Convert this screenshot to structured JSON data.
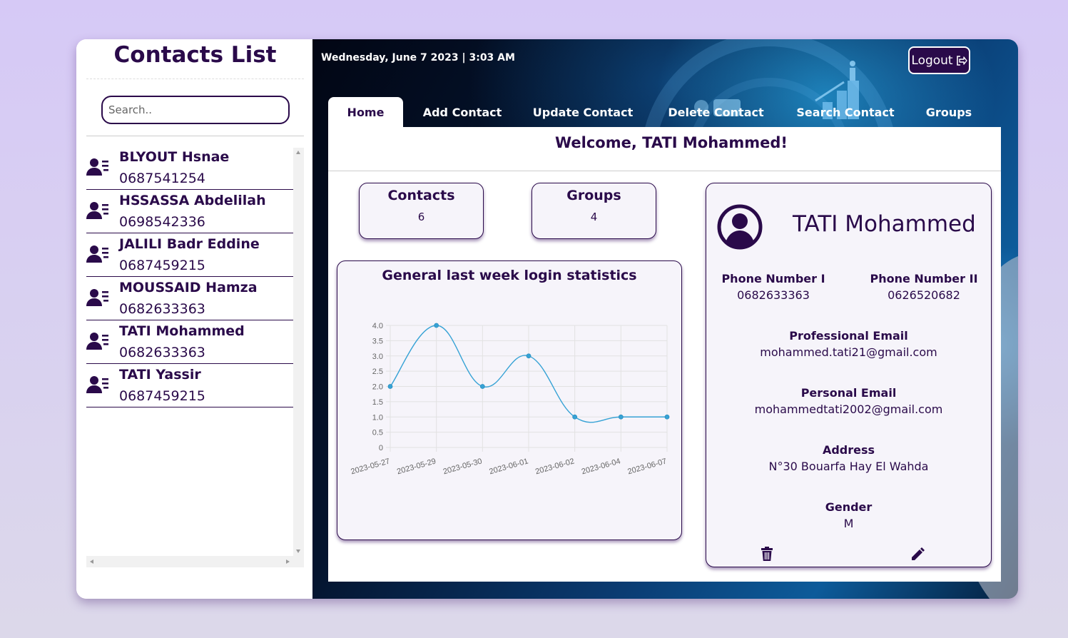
{
  "sidebar": {
    "title": "Contacts List",
    "search_placeholder": "Search..",
    "contacts": [
      {
        "name": "BLYOUT Hsnae",
        "phone": "0687541254"
      },
      {
        "name": "HSSASSA Abdelilah",
        "phone": "0698542336"
      },
      {
        "name": "JALILI Badr Eddine",
        "phone": "0687459215"
      },
      {
        "name": "MOUSSAID Hamza",
        "phone": "0682633363"
      },
      {
        "name": "TATI Mohammed",
        "phone": "0682633363"
      },
      {
        "name": "TATI Yassir",
        "phone": "0687459215"
      }
    ]
  },
  "header": {
    "datetime": "Wednesday, June 7 2023 | 3:03 AM",
    "logout_label": "Logout"
  },
  "tabs": [
    {
      "label": "Home",
      "active": true
    },
    {
      "label": "Add Contact",
      "active": false
    },
    {
      "label": "Update Contact",
      "active": false
    },
    {
      "label": "Delete Contact",
      "active": false
    },
    {
      "label": "Search Contact",
      "active": false
    },
    {
      "label": "Groups",
      "active": false
    }
  ],
  "home": {
    "welcome": "Welcome, TATI Mohammed!",
    "stats": {
      "contacts_label": "Contacts",
      "contacts_value": "6",
      "groups_label": "Groups",
      "groups_value": "4"
    }
  },
  "chart_data": {
    "type": "line",
    "title": "General last week login statistics",
    "x": [
      "2023-05-27",
      "2023-05-29",
      "2023-05-30",
      "2023-06-01",
      "2023-06-02",
      "2023-06-04",
      "2023-06-07"
    ],
    "series": [
      {
        "values": [
          2,
          4,
          2,
          3,
          1,
          1,
          1
        ]
      }
    ],
    "ylim": [
      0,
      4
    ],
    "yticks": [
      "0",
      "0.5",
      "1.0",
      "1.5",
      "2.0",
      "2.5",
      "3.0",
      "3.5",
      "4.0"
    ],
    "grid": true,
    "color": "#36a2d5"
  },
  "profile": {
    "name": "TATI Mohammed",
    "phone1_label": "Phone Number I",
    "phone1": "0682633363",
    "phone2_label": "Phone Number II",
    "phone2": "0626520682",
    "pro_email_label": "Professional Email",
    "pro_email": "mohammed.tati21@gmail.com",
    "personal_email_label": "Personal Email",
    "personal_email": "mohammedtati2002@gmail.com",
    "address_label": "Address",
    "address": "N°30 Bouarfa Hay El Wahda",
    "gender_label": "Gender",
    "gender": "M"
  },
  "colors": {
    "primary": "#2a0a4a",
    "chart_line": "#36a2d5"
  }
}
